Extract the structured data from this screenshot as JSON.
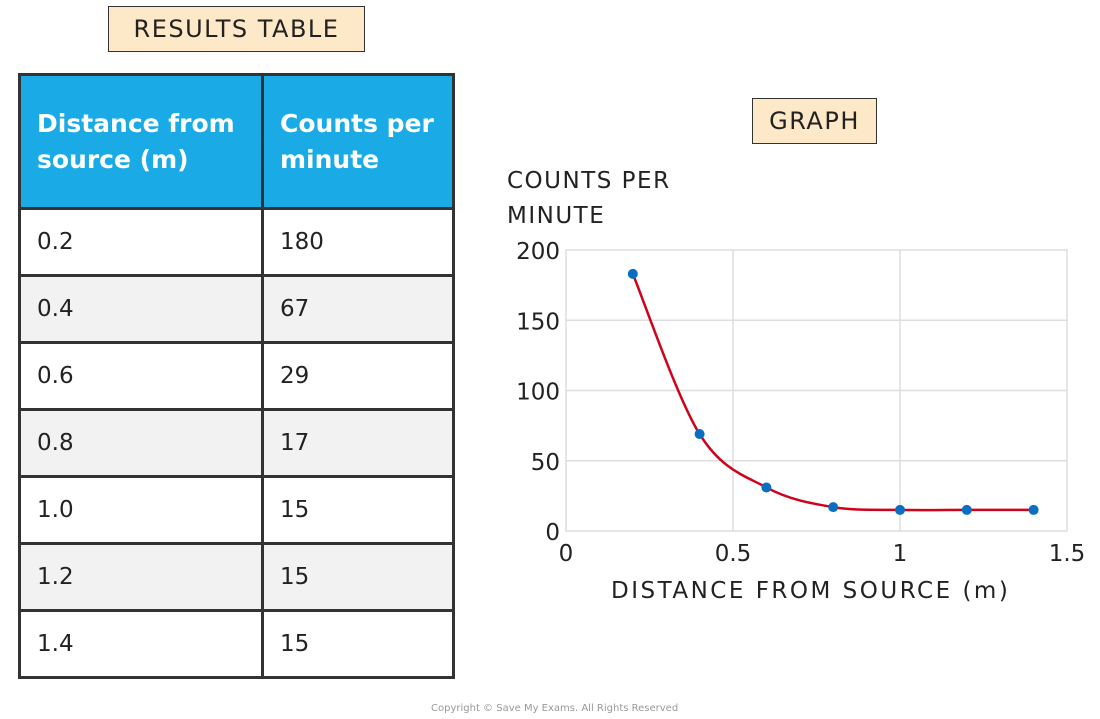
{
  "table_title": "RESULTS TABLE",
  "graph_title": "GRAPH",
  "table": {
    "headers": [
      "Distance from source (m)",
      "Counts per minute"
    ],
    "rows": [
      [
        "0.2",
        "180"
      ],
      [
        "0.4",
        "67"
      ],
      [
        "0.6",
        "29"
      ],
      [
        "0.8",
        "17"
      ],
      [
        "1.0",
        "15"
      ],
      [
        "1.2",
        "15"
      ],
      [
        "1.4",
        "15"
      ]
    ]
  },
  "chart_data": {
    "type": "line",
    "xlabel": "DISTANCE FROM SOURCE (m)",
    "ylabel": "COUNTS PER MINUTE",
    "xlim": [
      0,
      1.5
    ],
    "ylim": [
      0,
      200
    ],
    "xticks": [
      "0",
      "0.5",
      "1",
      "1.5"
    ],
    "yticks": [
      "0",
      "50",
      "100",
      "150",
      "200"
    ],
    "grid": true,
    "x": [
      0.2,
      0.4,
      0.6,
      0.8,
      1.0,
      1.2,
      1.4
    ],
    "y": [
      183,
      69,
      31,
      17,
      15,
      15,
      15
    ],
    "line_color": "#d0021b",
    "marker_color": "#0a6fc2",
    "smooth": true
  },
  "colors": {
    "header_bg": "#1aabe6",
    "label_bg": "#fde8c8"
  },
  "copyright": "Copyright © Save My Exams. All Rights Reserved"
}
